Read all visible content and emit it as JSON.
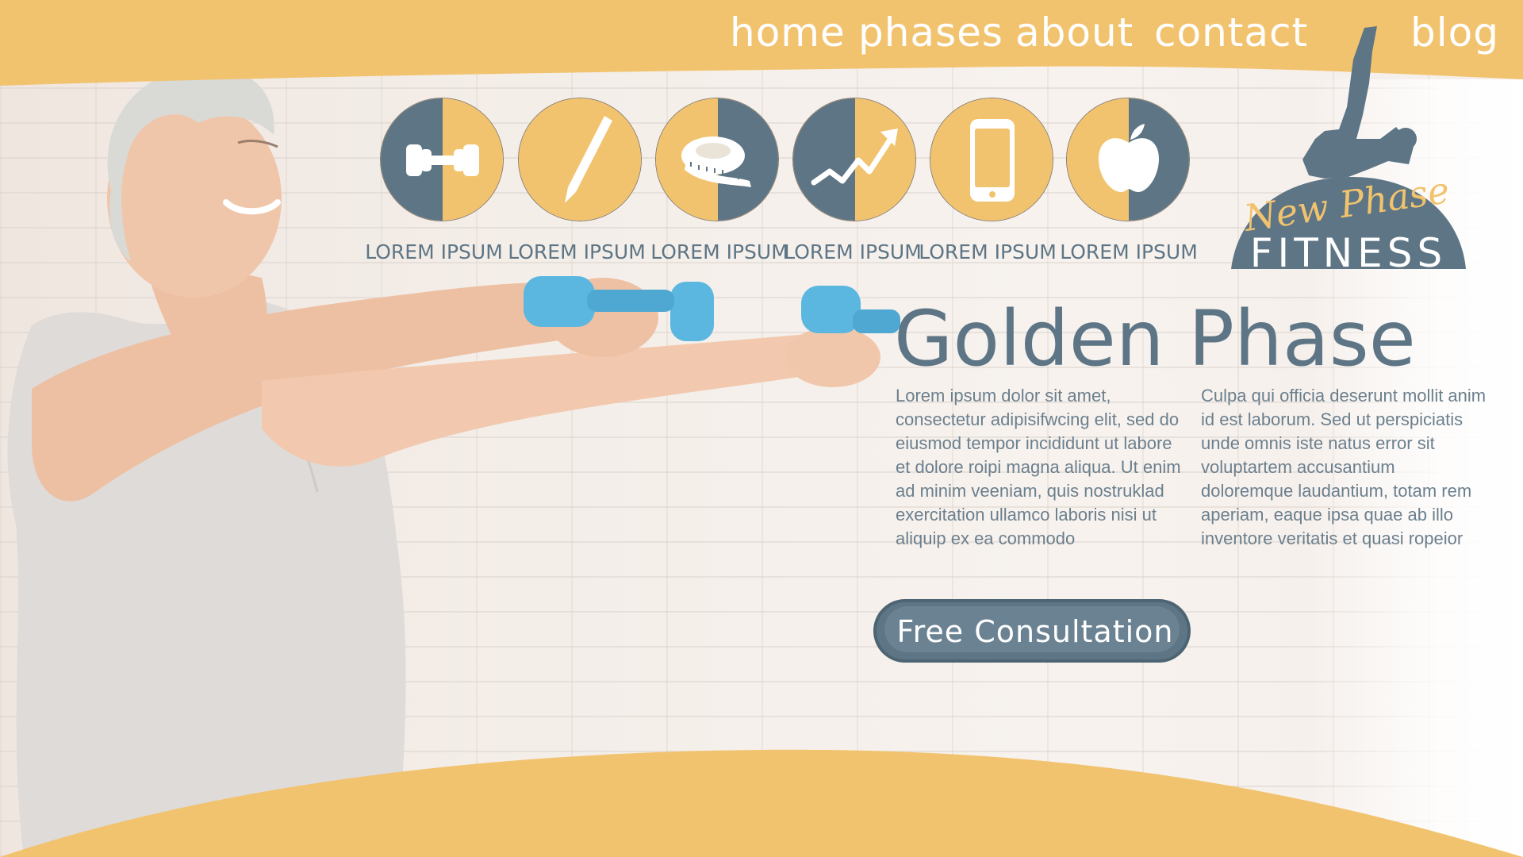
{
  "nav": {
    "items": [
      {
        "label": "home"
      },
      {
        "label": "phases"
      },
      {
        "label": "about"
      },
      {
        "label": "contact"
      },
      {
        "label": "blog"
      }
    ]
  },
  "colors": {
    "accent": "#f2c36e",
    "slate": "#5d7585",
    "button": "#5d7585"
  },
  "features": [
    {
      "icon": "dumbbell-icon",
      "label": "LOREM IPSUM"
    },
    {
      "icon": "pencil-icon",
      "label": "LOREM IPSUM"
    },
    {
      "icon": "measuring-tape-icon",
      "label": "LOREM IPSUM"
    },
    {
      "icon": "trend-chart-icon",
      "label": "LOREM IPSUM"
    },
    {
      "icon": "smartphone-icon",
      "label": "LOREM IPSUM"
    },
    {
      "icon": "apple-icon",
      "label": "LOREM IPSUM"
    }
  ],
  "logo": {
    "script": "New Phase",
    "wordmark": "FITNESS"
  },
  "hero": {
    "title": "Golden Phase",
    "column_left": "Lorem ipsum dolor sit amet, consectetur adipisifwcing elit, sed do eiusmod tempor incididunt ut labore et dolore roipi magna aliqua. Ut enim ad minim veeniam, quis nostruklad exercitation ullamco laboris nisi ut aliquip ex ea commodo",
    "column_right": "Culpa qui officia deserunt mollit anim id est laborum. Sed ut perspiciatis unde omnis iste natus error sit voluptartem accusantium doloremque laudantium, totam rem aperiam, eaque ipsa quae ab illo inventore veritatis et quasi ropeior",
    "cta_label": "Free Consultation"
  }
}
